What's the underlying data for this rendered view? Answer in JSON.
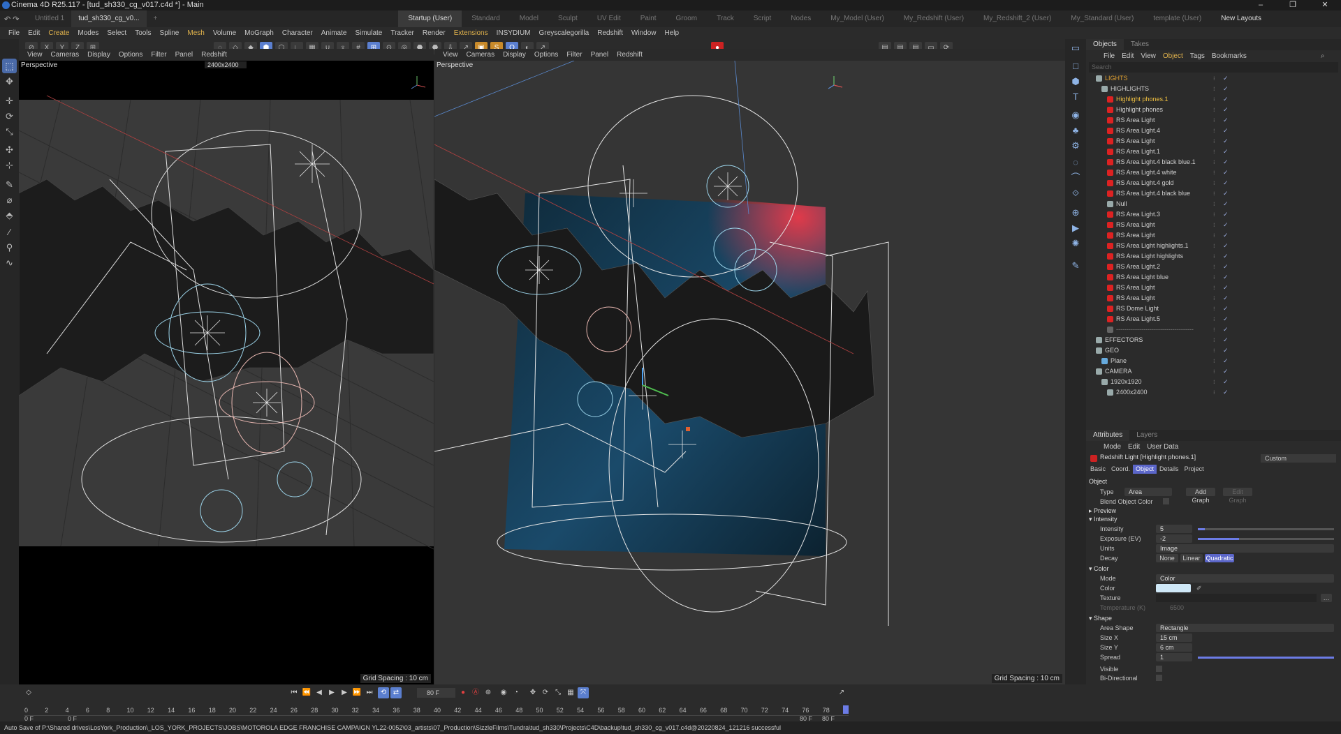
{
  "window": {
    "title": "Cinema 4D R25.117 - [tud_sh330_cg_v017.c4d *] - Main",
    "controls": [
      "–",
      "❐",
      "✕"
    ]
  },
  "doc_tabs": [
    "Untitled 1",
    "tud_sh330_cg_v0...",
    "+"
  ],
  "layout_tabs": [
    "Startup (User)",
    "Standard",
    "Model",
    "Sculpt",
    "UV Edit",
    "Paint",
    "Groom",
    "Track",
    "Script",
    "Nodes",
    "My_Model (User)",
    "My_Redshift (User)",
    "My_Redshift_2 (User)",
    "My_Standard (User)",
    "template (User)"
  ],
  "new_layouts": "New Layouts",
  "menu": [
    "File",
    "Edit",
    "Create",
    "Modes",
    "Select",
    "Tools",
    "Spline",
    "Mesh",
    "Volume",
    "MoGraph",
    "Character",
    "Animate",
    "Simulate",
    "Tracker",
    "Render",
    "Extensions",
    "INSYDIUM",
    "Greyscalegorilla",
    "Redshift",
    "Window",
    "Help"
  ],
  "toolbar": {
    "axes": [
      "X",
      "Y",
      "Z"
    ]
  },
  "viewports": {
    "menu": [
      "View",
      "Cameras",
      "Display",
      "Options",
      "Filter",
      "Panel",
      "Redshift"
    ],
    "left": {
      "label": "Perspective",
      "camera": "2400x2400",
      "grid": "Grid Spacing : 10 cm"
    },
    "right": {
      "label": "Perspective",
      "grid": "Grid Spacing : 10 cm"
    }
  },
  "objects_panel": {
    "tabs": [
      "Objects",
      "Takes"
    ],
    "menu": [
      "File",
      "Edit",
      "View",
      "Object",
      "Tags",
      "Bookmarks"
    ],
    "search_placeholder": "Search",
    "rows": [
      {
        "name": "LIGHTS",
        "indent": 0,
        "color": "#e0a030",
        "icon": "#9aa"
      },
      {
        "name": "HIGHLIGHTS",
        "indent": 1,
        "color": "#d0d0d0",
        "icon": "#9aa"
      },
      {
        "name": "Highlight phones.1",
        "indent": 2,
        "color": "#f0c040",
        "icon": "#d22"
      },
      {
        "name": "Highlight phones",
        "indent": 2,
        "color": "#d0d0d0",
        "icon": "#d22"
      },
      {
        "name": "RS Area Light",
        "indent": 2,
        "color": "#d0d0d0",
        "icon": "#d22"
      },
      {
        "name": "RS Area Light.4",
        "indent": 2,
        "color": "#d0d0d0",
        "icon": "#d22"
      },
      {
        "name": "RS Area Light",
        "indent": 2,
        "color": "#d0d0d0",
        "icon": "#d22"
      },
      {
        "name": "RS Area Light.1",
        "indent": 2,
        "color": "#d0d0d0",
        "icon": "#d22"
      },
      {
        "name": "RS Area Light.4 black blue.1",
        "indent": 2,
        "color": "#d0d0d0",
        "icon": "#d22"
      },
      {
        "name": "RS Area Light.4  white",
        "indent": 2,
        "color": "#d0d0d0",
        "icon": "#d22"
      },
      {
        "name": "RS Area Light.4  gold",
        "indent": 2,
        "color": "#d0d0d0",
        "icon": "#d22"
      },
      {
        "name": "RS Area Light.4 black blue",
        "indent": 2,
        "color": "#d0d0d0",
        "icon": "#d22"
      },
      {
        "name": "Null",
        "indent": 2,
        "color": "#d0d0d0",
        "icon": "#9aa"
      },
      {
        "name": "RS Area Light.3",
        "indent": 2,
        "color": "#d0d0d0",
        "icon": "#d22"
      },
      {
        "name": "RS Area Light",
        "indent": 2,
        "color": "#d0d0d0",
        "icon": "#d22"
      },
      {
        "name": "RS Area Light",
        "indent": 2,
        "color": "#d0d0d0",
        "icon": "#d22"
      },
      {
        "name": "RS Area Light highlights.1",
        "indent": 2,
        "color": "#d0d0d0",
        "icon": "#d22"
      },
      {
        "name": "RS Area Light highlights",
        "indent": 2,
        "color": "#d0d0d0",
        "icon": "#d22"
      },
      {
        "name": "RS Area Light.2",
        "indent": 2,
        "color": "#d0d0d0",
        "icon": "#d22"
      },
      {
        "name": "RS Area Light blue",
        "indent": 2,
        "color": "#d0d0d0",
        "icon": "#d22"
      },
      {
        "name": "RS Area Light",
        "indent": 2,
        "color": "#d0d0d0",
        "icon": "#d22"
      },
      {
        "name": "RS Area Light",
        "indent": 2,
        "color": "#d0d0d0",
        "icon": "#d22"
      },
      {
        "name": "RS Dome Light",
        "indent": 2,
        "color": "#d0d0d0",
        "icon": "#d22"
      },
      {
        "name": "RS Area Light.5",
        "indent": 2,
        "color": "#d0d0d0",
        "icon": "#d22"
      },
      {
        "name": "-------------------------------------",
        "indent": 2,
        "color": "#888",
        "icon": "#666"
      },
      {
        "name": "EFFECTORS",
        "indent": 0,
        "color": "#d0d0d0",
        "icon": "#9aa"
      },
      {
        "name": "GEO",
        "indent": 0,
        "color": "#d0d0d0",
        "icon": "#9aa"
      },
      {
        "name": "Plane",
        "indent": 1,
        "color": "#d0d0d0",
        "icon": "#6ad"
      },
      {
        "name": "CAMERA",
        "indent": 0,
        "color": "#d0d0d0",
        "icon": "#9aa"
      },
      {
        "name": "1920x1920",
        "indent": 1,
        "color": "#d0d0d0",
        "icon": "#9aa"
      },
      {
        "name": "2400x2400",
        "indent": 2,
        "color": "#d0d0d0",
        "icon": "#9aa"
      }
    ]
  },
  "attributes": {
    "tabs": [
      "Attributes",
      "Layers"
    ],
    "menu": [
      "Mode",
      "Edit",
      "User Data"
    ],
    "object_title": "Redshift Light [Highlight phones.1]",
    "preset": "Custom",
    "subtabs": [
      "Basic",
      "Coord.",
      "Object",
      "Details",
      "Project"
    ],
    "section_object": "Object",
    "type_label": "Type",
    "type_value": "Area",
    "add_graph": "Add Graph",
    "edit_graph": "Edit Graph",
    "blend_label": "Blend Object Color",
    "preview": "Preview",
    "intensity_section": "Intensity",
    "intensity_label": "Intensity",
    "intensity_value": "5",
    "intensity_level": 0.05,
    "exposure_label": "Exposure (EV)",
    "exposure_value": "-2",
    "exposure_level": 0.3,
    "units_label": "Units",
    "units_value": "Image",
    "decay_label": "Decay",
    "decay_options": [
      "None",
      "Linear",
      "Quadratic"
    ],
    "color_section": "Color",
    "mode_label": "Mode",
    "mode_value": "Color",
    "color_label": "Color",
    "color_swatch": "#cfe8f7",
    "texture_label": "Texture",
    "temp_label": "Temperature (K)",
    "temp_value": "6500",
    "shape_section": "Shape",
    "area_shape_label": "Area Shape",
    "area_shape_value": "Rectangle",
    "sizex_label": "Size X",
    "sizex_value": "15 cm",
    "sizey_label": "Size Y",
    "sizey_value": "6 cm",
    "spread_label": "Spread",
    "spread_value": "1",
    "spread_level": 1.0,
    "visible_label": "Visible",
    "bidir_label": "Bi-Directional"
  },
  "timeline": {
    "current_frame": "80 F",
    "start": "0 F",
    "start2": "0 F",
    "end": "80 F",
    "end2": "80 F",
    "ticks": [
      "0",
      "2",
      "4",
      "6",
      "8",
      "10",
      "12",
      "14",
      "16",
      "18",
      "20",
      "22",
      "24",
      "26",
      "28",
      "30",
      "32",
      "34",
      "36",
      "38",
      "40",
      "42",
      "44",
      "46",
      "48",
      "50",
      "52",
      "54",
      "56",
      "58",
      "60",
      "62",
      "64",
      "66",
      "68",
      "70",
      "72",
      "74",
      "76",
      "78"
    ]
  },
  "status": "Auto Save of P:\\Shared drives\\LosYork_Production\\_LOS_YORK_PROJECTS\\JOBS\\MOTOROLA EDGE FRANCHISE CAMPAIGN   YL22-0052\\03_artists\\07_Production\\SizzleFilms\\Tundra\\tud_sh330\\Projects\\C4D\\backup\\tud_sh330_cg_v017.c4d@20220824_121216 successful"
}
